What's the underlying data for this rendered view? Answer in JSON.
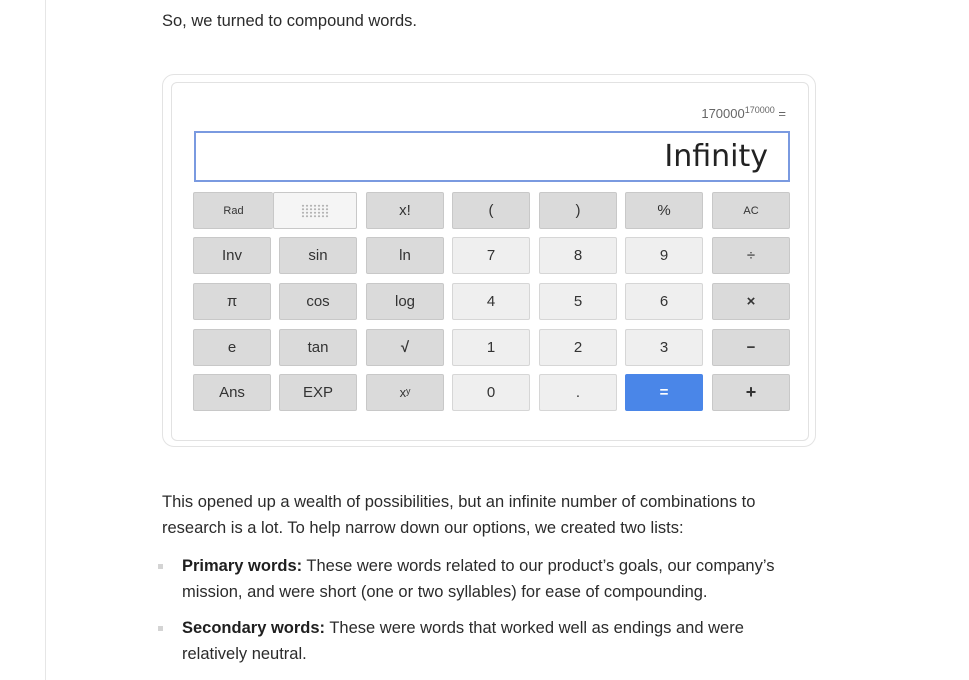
{
  "intro_text": "So, we turned to compound words.",
  "calculator": {
    "expression_base": "170000",
    "expression_exponent": "170000",
    "expression_suffix": " =",
    "display_value": "Infinity",
    "keys": {
      "rad": "Rad",
      "factorial": "x!",
      "open_paren": "(",
      "close_paren": ")",
      "percent": "%",
      "all_clear": "AC",
      "inv": "Inv",
      "sin": "sin",
      "ln": "ln",
      "seven": "7",
      "eight": "8",
      "nine": "9",
      "divide": "÷",
      "pi": "π",
      "cos": "cos",
      "log": "log",
      "four": "4",
      "five": "5",
      "six": "6",
      "multiply": "×",
      "e": "e",
      "tan": "tan",
      "sqrt": "√",
      "one": "1",
      "two": "2",
      "three": "3",
      "minus": "−",
      "ans": "Ans",
      "exp": "EXP",
      "power": "xʸ",
      "zero": "0",
      "decimal": ".",
      "equals": "=",
      "plus": "+"
    }
  },
  "body_text": "This opened up a wealth of possibilities, but an infinite number of combinations to research is a lot. To help narrow down our options, we created two lists:",
  "list": [
    {
      "term": "Primary words:",
      "desc": " These were words related to our product’s goals, our company’s mission, and were short (one or two syllables) for ease of compounding."
    },
    {
      "term": "Secondary words:",
      "desc": " These were words that worked well as endings and were relatively neutral."
    }
  ]
}
